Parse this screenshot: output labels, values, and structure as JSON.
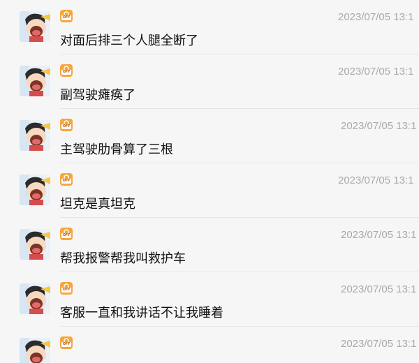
{
  "feed": {
    "items": [
      {
        "status": "OFF",
        "timestamp": "2023/07/05 13:1",
        "message": "对面后排三个人腿全断了"
      },
      {
        "status": "OFF",
        "timestamp": "2023/07/05 13:1",
        "message": "副驾驶瘫痪了"
      },
      {
        "status": "OFF",
        "timestamp": "2023/07/05 13:1",
        "message": "主驾驶肋骨算了三根"
      },
      {
        "status": "OFF",
        "timestamp": "2023/07/05 13:1",
        "message": "坦克是真坦克"
      },
      {
        "status": "OFF",
        "timestamp": "2023/07/05 13:1",
        "message": "帮我报警帮我叫救护车"
      },
      {
        "status": "OFF",
        "timestamp": "2023/07/05 13:1",
        "message": "客服一直和我讲话不让我睡着"
      },
      {
        "status": "OFF",
        "timestamp": "2023/07/05 13:1",
        "message": ""
      }
    ]
  },
  "colors": {
    "background": "#f6f6f6",
    "badge": "#f6a63a",
    "timestamp": "#a9a9a9",
    "message": "#111111",
    "divider": "#e6e6e6"
  },
  "icons": {
    "avatar": "cartoon-boy-avatar",
    "badge": "lock-off-badge-icon"
  }
}
